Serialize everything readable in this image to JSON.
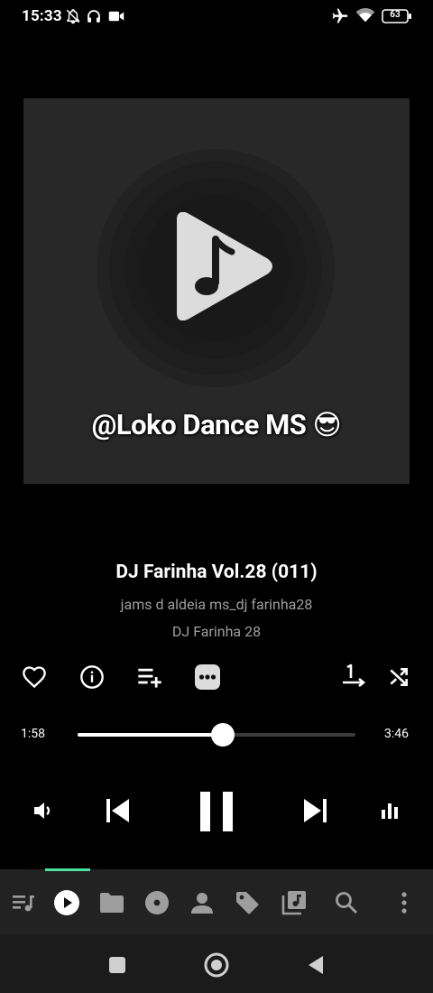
{
  "status_bar": {
    "time": "15:33",
    "battery": "63",
    "icons": [
      "bell-off-icon",
      "headphones-icon",
      "video-camera-icon",
      "airplane-icon",
      "wifi-icon",
      "battery-icon"
    ]
  },
  "album_art": {
    "overlay_text": "@Loko Dance MS 😎",
    "icon": "music-play-icon"
  },
  "track": {
    "title": "DJ Farinha Vol.28 (011)",
    "artist": "jams d aldeia ms_dj farinha28",
    "album": "DJ Farinha 28"
  },
  "actions": [
    "heart-icon",
    "info-icon",
    "add-to-queue-icon",
    "more-icon",
    "repeat-one-icon",
    "shuffle-icon"
  ],
  "progress": {
    "elapsed": "1:58",
    "total": "3:46",
    "fraction": 0.522
  },
  "controls": [
    "volume-icon",
    "previous-icon",
    "pause-icon",
    "next-icon",
    "equalizer-icon"
  ],
  "bottom_nav": {
    "active_index": 1,
    "items": [
      "queue-icon",
      "now-playing-icon",
      "folder-icon",
      "album-icon",
      "artist-icon",
      "tag-icon",
      "playlist-icon",
      "search-icon",
      "overflow-menu-icon"
    ]
  },
  "colors": {
    "accent": "#4be3a0",
    "background": "#000000",
    "secondary_text": "#9e9e9e",
    "art_background": "#282828"
  }
}
